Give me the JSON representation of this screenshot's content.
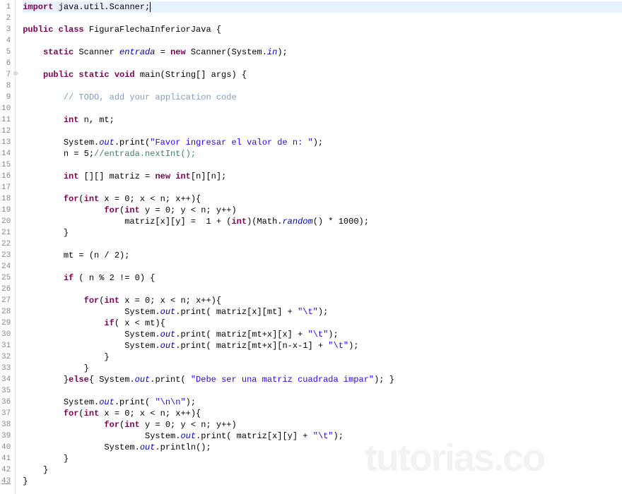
{
  "watermark": "tutorias.co",
  "lines": [
    {
      "num": 1,
      "highlighted": true,
      "tokens": [
        [
          "kw",
          "import"
        ],
        [
          "",
          " java.util.Scanner;"
        ],
        [
          "cursor",
          ""
        ]
      ]
    },
    {
      "num": 2,
      "tokens": []
    },
    {
      "num": 3,
      "tokens": [
        [
          "kw",
          "public class"
        ],
        [
          "",
          " FiguraFlechaInferiorJava {"
        ]
      ]
    },
    {
      "num": 4,
      "tokens": []
    },
    {
      "num": 5,
      "tokens": [
        [
          "",
          "    "
        ],
        [
          "kw",
          "static"
        ],
        [
          "",
          " Scanner "
        ],
        [
          "fld",
          "entrada"
        ],
        [
          "",
          " = "
        ],
        [
          "kw",
          "new"
        ],
        [
          "",
          " Scanner(System."
        ],
        [
          "fld",
          "in"
        ],
        [
          "",
          ");"
        ]
      ]
    },
    {
      "num": 6,
      "tokens": []
    },
    {
      "num": 7,
      "circled": true,
      "tokens": [
        [
          "",
          "    "
        ],
        [
          "kw",
          "public static void"
        ],
        [
          "",
          " main(String[] args) {"
        ]
      ]
    },
    {
      "num": 8,
      "tokens": []
    },
    {
      "num": 9,
      "tokens": [
        [
          "",
          "        "
        ],
        [
          "cmt-todo",
          "// TODO, add your application code"
        ]
      ]
    },
    {
      "num": 10,
      "tokens": []
    },
    {
      "num": 11,
      "tokens": [
        [
          "",
          "        "
        ],
        [
          "kw",
          "int"
        ],
        [
          "",
          " n, mt;"
        ]
      ]
    },
    {
      "num": 12,
      "tokens": []
    },
    {
      "num": 13,
      "tokens": [
        [
          "",
          "        System."
        ],
        [
          "fld",
          "out"
        ],
        [
          "",
          ".print("
        ],
        [
          "str",
          "\"Favor ingresar el valor de n: \""
        ],
        [
          "",
          ");"
        ]
      ]
    },
    {
      "num": 14,
      "tokens": [
        [
          "",
          "        n = 5;"
        ],
        [
          "cmt",
          "//entrada.nextInt();"
        ]
      ]
    },
    {
      "num": 15,
      "tokens": []
    },
    {
      "num": 16,
      "tokens": [
        [
          "",
          "        "
        ],
        [
          "kw",
          "int"
        ],
        [
          "",
          " [][] matriz = "
        ],
        [
          "kw",
          "new int"
        ],
        [
          "",
          "[n][n];"
        ]
      ]
    },
    {
      "num": 17,
      "tokens": []
    },
    {
      "num": 18,
      "tokens": [
        [
          "",
          "        "
        ],
        [
          "kw",
          "for"
        ],
        [
          "",
          "("
        ],
        [
          "kw",
          "int"
        ],
        [
          "",
          " x = 0; x < n; x++){"
        ]
      ]
    },
    {
      "num": 19,
      "tokens": [
        [
          "",
          "                "
        ],
        [
          "kw",
          "for"
        ],
        [
          "",
          "("
        ],
        [
          "kw",
          "int"
        ],
        [
          "",
          " y = 0; y < n; y++)"
        ]
      ]
    },
    {
      "num": 20,
      "tokens": [
        [
          "",
          "                    matriz[x][y] =  1 + ("
        ],
        [
          "kw",
          "int"
        ],
        [
          "",
          ")(Math."
        ],
        [
          "fld",
          "random"
        ],
        [
          "",
          "() * 1000);"
        ]
      ]
    },
    {
      "num": 21,
      "tokens": [
        [
          "",
          "        }"
        ]
      ]
    },
    {
      "num": 22,
      "tokens": []
    },
    {
      "num": 23,
      "tokens": [
        [
          "",
          "        mt = (n / 2);"
        ]
      ]
    },
    {
      "num": 24,
      "tokens": []
    },
    {
      "num": 25,
      "tokens": [
        [
          "",
          "        "
        ],
        [
          "kw",
          "if"
        ],
        [
          "",
          " ( n % 2 != 0) {"
        ]
      ]
    },
    {
      "num": 26,
      "tokens": []
    },
    {
      "num": 27,
      "tokens": [
        [
          "",
          "            "
        ],
        [
          "kw",
          "for"
        ],
        [
          "",
          "("
        ],
        [
          "kw",
          "int"
        ],
        [
          "",
          " x = 0; x < n; x++){"
        ]
      ]
    },
    {
      "num": 28,
      "tokens": [
        [
          "",
          "                    System."
        ],
        [
          "fld",
          "out"
        ],
        [
          "",
          ".print( matriz[x][mt] + "
        ],
        [
          "str",
          "\"\\t\""
        ],
        [
          "",
          ");"
        ]
      ]
    },
    {
      "num": 29,
      "tokens": [
        [
          "",
          "                "
        ],
        [
          "kw",
          "if"
        ],
        [
          "",
          "( x < mt){"
        ]
      ]
    },
    {
      "num": 30,
      "tokens": [
        [
          "",
          "                    System."
        ],
        [
          "fld",
          "out"
        ],
        [
          "",
          ".print( matriz[mt+x][x] + "
        ],
        [
          "str",
          "\"\\t\""
        ],
        [
          "",
          ");"
        ]
      ]
    },
    {
      "num": 31,
      "tokens": [
        [
          "",
          "                    System."
        ],
        [
          "fld",
          "out"
        ],
        [
          "",
          ".print( matriz[mt+x][n-x-1] + "
        ],
        [
          "str",
          "\"\\t\""
        ],
        [
          "",
          ");"
        ]
      ]
    },
    {
      "num": 32,
      "tokens": [
        [
          "",
          "                }"
        ]
      ]
    },
    {
      "num": 33,
      "tokens": [
        [
          "",
          "            }"
        ]
      ]
    },
    {
      "num": 34,
      "tokens": [
        [
          "",
          "        }"
        ],
        [
          "kw",
          "else"
        ],
        [
          "",
          "{ System."
        ],
        [
          "fld",
          "out"
        ],
        [
          "",
          ".print( "
        ],
        [
          "str",
          "\"Debe ser una matriz cuadrada impar\""
        ],
        [
          "",
          "); }"
        ]
      ]
    },
    {
      "num": 35,
      "tokens": []
    },
    {
      "num": 36,
      "tokens": [
        [
          "",
          "        System."
        ],
        [
          "fld",
          "out"
        ],
        [
          "",
          ".print( "
        ],
        [
          "str",
          "\"\\n\\n\""
        ],
        [
          "",
          ");"
        ]
      ]
    },
    {
      "num": 37,
      "tokens": [
        [
          "",
          "        "
        ],
        [
          "kw",
          "for"
        ],
        [
          "",
          "("
        ],
        [
          "kw",
          "int"
        ],
        [
          "",
          " x = 0; x < n; x++){"
        ]
      ]
    },
    {
      "num": 38,
      "tokens": [
        [
          "",
          "                "
        ],
        [
          "kw",
          "for"
        ],
        [
          "",
          "("
        ],
        [
          "kw",
          "int"
        ],
        [
          "",
          " y = 0; y < n; y++)"
        ]
      ]
    },
    {
      "num": 39,
      "tokens": [
        [
          "",
          "                        System."
        ],
        [
          "fld",
          "out"
        ],
        [
          "",
          ".print( matriz[x][y] + "
        ],
        [
          "str",
          "\"\\t\""
        ],
        [
          "",
          ");"
        ]
      ]
    },
    {
      "num": 40,
      "tokens": [
        [
          "",
          "                System."
        ],
        [
          "fld",
          "out"
        ],
        [
          "",
          ".println();"
        ]
      ]
    },
    {
      "num": 41,
      "tokens": [
        [
          "",
          "        }"
        ]
      ]
    },
    {
      "num": 42,
      "tokens": [
        [
          "",
          "    }"
        ]
      ]
    },
    {
      "num": 43,
      "underline": true,
      "tokens": [
        [
          "",
          "}"
        ]
      ]
    }
  ]
}
